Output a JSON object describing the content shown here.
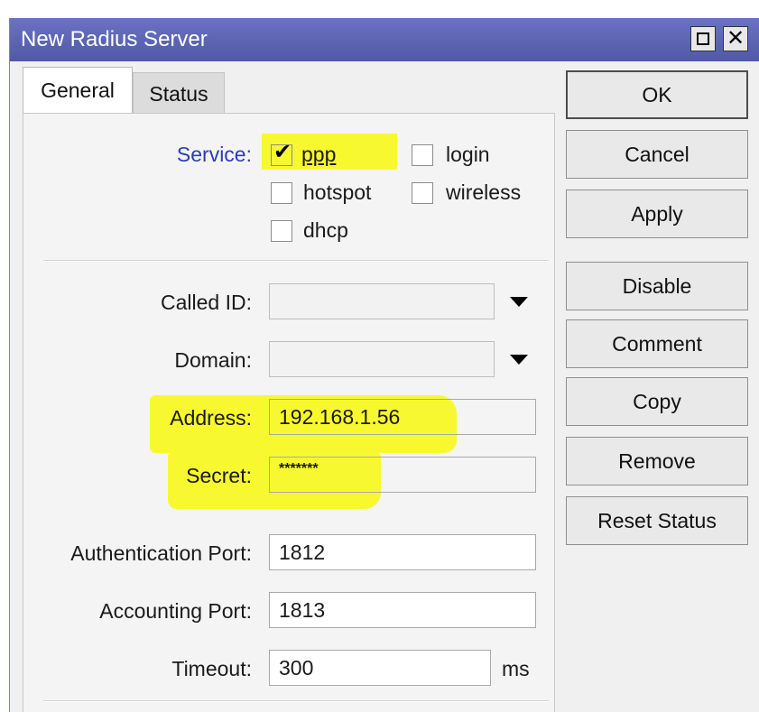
{
  "window": {
    "title": "New Radius Server"
  },
  "tabs": [
    {
      "label": "General",
      "active": true
    },
    {
      "label": "Status",
      "active": false
    }
  ],
  "service": {
    "label": "Service:",
    "options": [
      {
        "label": "ppp",
        "checked": true
      },
      {
        "label": "login",
        "checked": false
      },
      {
        "label": "hotspot",
        "checked": false
      },
      {
        "label": "wireless",
        "checked": false
      },
      {
        "label": "dhcp",
        "checked": false
      }
    ]
  },
  "fields": {
    "called_id": {
      "label": "Called ID:",
      "value": ""
    },
    "domain": {
      "label": "Domain:",
      "value": ""
    },
    "address": {
      "label": "Address:",
      "value": "192.168.1.56"
    },
    "secret": {
      "label": "Secret:",
      "value": "*******"
    },
    "auth_port": {
      "label": "Authentication Port:",
      "value": "1812"
    },
    "acct_port": {
      "label": "Accounting Port:",
      "value": "1813"
    },
    "timeout": {
      "label": "Timeout:",
      "value": "300",
      "unit": "ms"
    }
  },
  "buttons": {
    "ok": "OK",
    "cancel": "Cancel",
    "apply": "Apply",
    "disable": "Disable",
    "comment": "Comment",
    "copy": "Copy",
    "remove": "Remove",
    "reset_status": "Reset Status"
  },
  "colors": {
    "titlebar": "#5c64b4",
    "highlight": "#f7f71e",
    "service_label": "#2b3bbd"
  }
}
